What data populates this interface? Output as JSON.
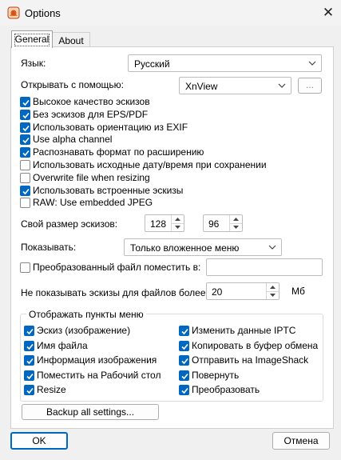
{
  "window": {
    "title": "Options",
    "close_glyph": "✕"
  },
  "tabs": [
    {
      "label": "General"
    },
    {
      "label": "About"
    }
  ],
  "language": {
    "label": "Язык:",
    "value": "Русский"
  },
  "open_with": {
    "label": "Открывать с помощью:",
    "value": "XnView",
    "browse_label": "..."
  },
  "options": [
    {
      "label": "Высокое качество эскизов",
      "checked": true
    },
    {
      "label": "Без эскизов для EPS/PDF",
      "checked": true
    },
    {
      "label": "Использовать ориентацию из EXIF",
      "checked": true
    },
    {
      "label": "Use alpha channel",
      "checked": true
    },
    {
      "label": "Распознавать формат по расширению",
      "checked": true
    },
    {
      "label": "Использовать исходные дату/время при сохранении",
      "checked": false
    },
    {
      "label": "Overwrite file when resizing",
      "checked": false
    },
    {
      "label": "Использовать встроенные эскизы",
      "checked": true
    },
    {
      "label": "RAW: Use embedded JPEG",
      "checked": false
    }
  ],
  "thumb_size": {
    "label": "Свой размер эскизов:",
    "width": "128",
    "height": "96"
  },
  "show": {
    "label": "Показывать:",
    "value": "Только вложенное меню"
  },
  "convert_file": {
    "label": "Преобразованный файл поместить в:",
    "checked": false,
    "value": ""
  },
  "max_size": {
    "label": "Не показывать эскизы для файлов более:",
    "value": "20",
    "unit": "Мб"
  },
  "menu_group": {
    "title": "Отображать пункты меню",
    "left": [
      {
        "label": "Эскиз (изображение)",
        "checked": true
      },
      {
        "label": "Имя файла",
        "checked": true
      },
      {
        "label": "Информация изображения",
        "checked": true
      },
      {
        "label": "Поместить на Рабочий стол",
        "checked": true
      },
      {
        "label": "Resize",
        "checked": true
      }
    ],
    "right": [
      {
        "label": "Изменить данные IPTC",
        "checked": true
      },
      {
        "label": "Копировать в буфер обмена",
        "checked": true
      },
      {
        "label": "Отправить на ImageShack",
        "checked": true
      },
      {
        "label": "Повернуть",
        "checked": true
      },
      {
        "label": "Преобразовать",
        "checked": true
      }
    ]
  },
  "backup_label": "Backup all settings...",
  "footer": {
    "ok_label": "OK",
    "cancel_label": "Отмена"
  },
  "colors": {
    "accent": "#0067c0"
  }
}
